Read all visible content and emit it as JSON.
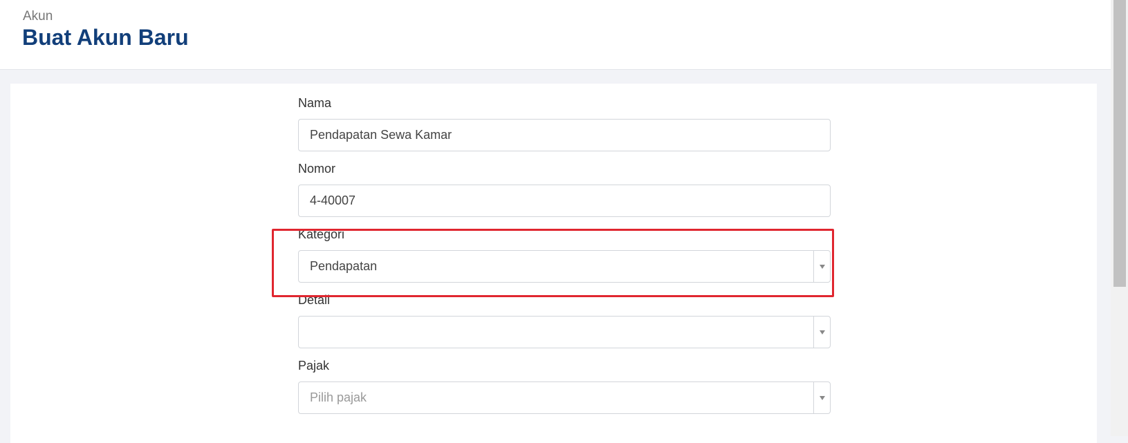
{
  "header": {
    "breadcrumb": "Akun",
    "title": "Buat Akun Baru"
  },
  "form": {
    "nama": {
      "label": "Nama",
      "value": "Pendapatan Sewa Kamar"
    },
    "nomor": {
      "label": "Nomor",
      "value": "4-40007"
    },
    "kategori": {
      "label": "Kategori",
      "value": "Pendapatan"
    },
    "detail": {
      "label": "Detail",
      "value": ""
    },
    "pajak": {
      "label": "Pajak",
      "placeholder": "Pilih pajak"
    }
  },
  "colors": {
    "title": "#123f7a",
    "highlight": "#e0262f"
  },
  "icons": {
    "dropdown": "chevron-down-icon"
  }
}
